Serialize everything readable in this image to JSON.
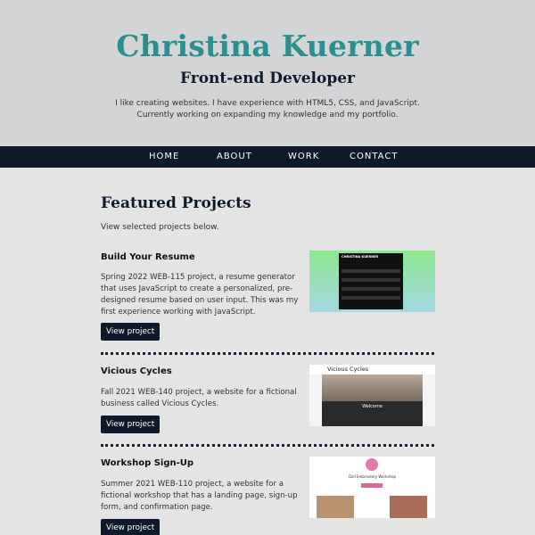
{
  "header": {
    "name": "Christina Kuerner",
    "role": "Front-end Developer",
    "bio": "I like creating websites. I have experience with HTML5, CSS, and JavaScript. Currently working on expanding my knowledge and my portfolio."
  },
  "nav": {
    "items": [
      {
        "label": "HOME"
      },
      {
        "label": "ABOUT"
      },
      {
        "label": "WORK"
      },
      {
        "label": "CONTACT"
      }
    ]
  },
  "featured": {
    "title": "Featured Projects",
    "subtitle": "View selected projects below."
  },
  "projects": [
    {
      "title": "Build Your Resume",
      "description": "Spring 2022 WEB-115 project, a resume generator that uses JavaScript to create a personalized, pre-designed resume based on user input. This was my first experience working with JavaScript.",
      "button": "View project",
      "thumb_text": "CHRISTINA KUERNER"
    },
    {
      "title": "Vicious Cycles",
      "description": "Fall 2021 WEB-140 project, a website for a fictional business called Vicious Cycles.",
      "button": "View project",
      "thumb_text": "Vicious Cycles",
      "thumb_welcome": "Welcome"
    },
    {
      "title": "Workshop Sign-Up",
      "description": "Summer 2021 WEB-110 project, a website for a fictional workshop that has a landing page, sign-up form, and confirmation page.",
      "button": "View project",
      "thumb_text": "Doll Embroidery Workshop"
    }
  ],
  "colors": {
    "accent": "#2b8f8f",
    "navy": "#0e1a2b"
  }
}
